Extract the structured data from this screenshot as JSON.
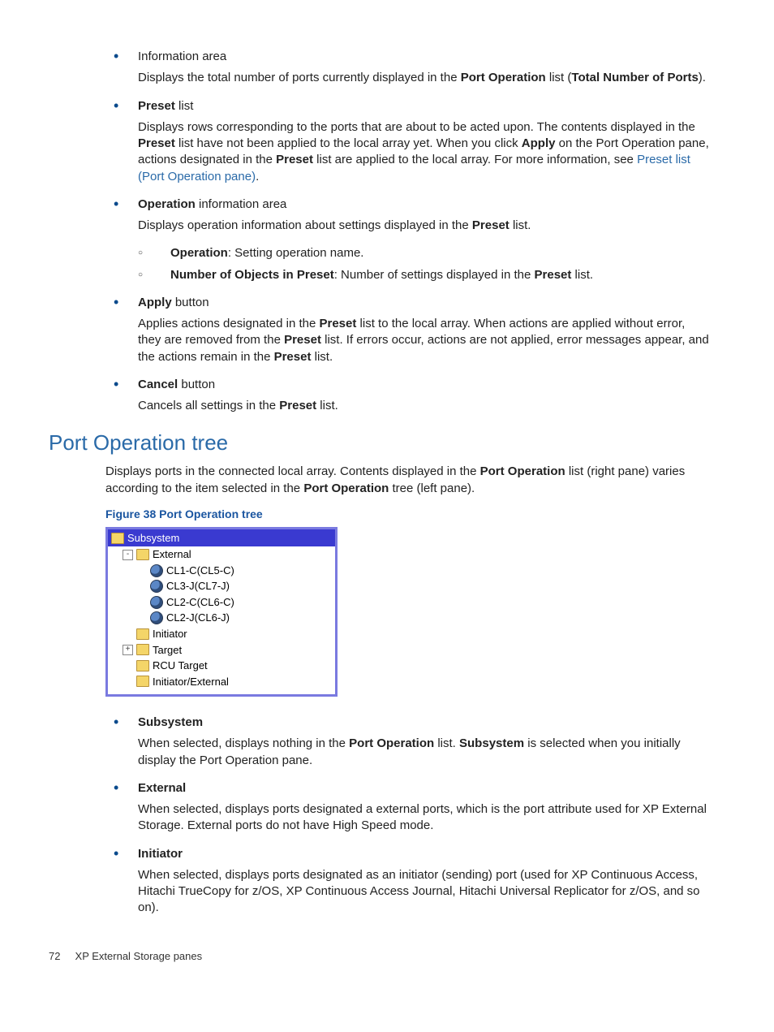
{
  "items": [
    {
      "head_plain": "Information area",
      "body_html": "Displays the total number of ports currently displayed in the <b>Port Operation</b> list (<b>Total Number of Ports</b>)."
    },
    {
      "head_html": "<b>Preset</b> list",
      "body_html": "Displays rows corresponding to the ports that are about to be acted upon. The contents displayed in the <b>Preset</b> list have not been applied to the local array yet. When you click <b>Apply</b> on the Port Operation pane, actions designated in the <b>Preset</b> list are applied to the local array. For more information, see <a class='link' href='#'>Preset list (Port Operation pane)</a>."
    },
    {
      "head_html": "<b>Operation</b> information area",
      "body_html": "Displays operation information about settings displayed in the <b>Preset</b> list.",
      "sub": [
        "<b>Operation</b>: Setting operation name.",
        "<b>Number of Objects in Preset</b>: Number of settings displayed in the <b>Preset</b> list."
      ]
    },
    {
      "head_html": "<b>Apply</b> button",
      "body_html": "Applies actions designated in the <b>Preset</b> list to the local array. When actions are applied without error, they are removed from the <b>Preset</b> list. If errors occur, actions are not applied, error messages appear, and the actions remain in the <b>Preset</b> list."
    },
    {
      "head_html": "<b>Cancel</b> button",
      "body_html": "Cancels all settings in the <b>Preset</b> list."
    }
  ],
  "section_title": "Port Operation tree",
  "section_intro_html": "Displays ports in the connected local array. Contents displayed in the <b>Port Operation</b> list (right pane) varies according to the item selected in the <b>Port Operation</b> tree (left pane).",
  "figure_caption": "Figure 38 Port Operation tree",
  "tree": {
    "root": "Subsystem",
    "nodes": [
      {
        "type": "folder",
        "expand": "-",
        "indent": 0,
        "label": "External"
      },
      {
        "type": "globe",
        "indent": 1,
        "label": "CL1-C(CL5-C)"
      },
      {
        "type": "globe",
        "indent": 1,
        "label": "CL3-J(CL7-J)"
      },
      {
        "type": "globe",
        "indent": 1,
        "label": "CL2-C(CL6-C)"
      },
      {
        "type": "globe",
        "indent": 1,
        "label": "CL2-J(CL6-J)"
      },
      {
        "type": "folder",
        "expand": "",
        "indent": 0,
        "label": "Initiator"
      },
      {
        "type": "folder",
        "expand": "+",
        "indent": 0,
        "label": "Target"
      },
      {
        "type": "folder",
        "expand": "",
        "indent": 0,
        "label": "RCU Target"
      },
      {
        "type": "folder",
        "expand": "",
        "indent": 0,
        "label": "Initiator/External"
      }
    ]
  },
  "items2": [
    {
      "head_html": "<b>Subsystem</b>",
      "body_html": "When selected, displays nothing in the <b>Port Operation</b> list. <b>Subsystem</b> is selected when you initially display the Port Operation pane."
    },
    {
      "head_html": "<b>External</b>",
      "body_html": "When selected, displays ports designated a external ports, which is the port attribute used for XP External Storage. External ports do not have High Speed mode."
    },
    {
      "head_html": "<b>Initiator</b>",
      "body_html": "When selected, displays ports designated as an initiator (sending) port (used for XP Continuous Access, Hitachi TrueCopy for z/OS, XP Continuous Access Journal, Hitachi Universal Replicator for z/OS, and so on)."
    }
  ],
  "footer_page": "72",
  "footer_text": "XP External Storage panes"
}
